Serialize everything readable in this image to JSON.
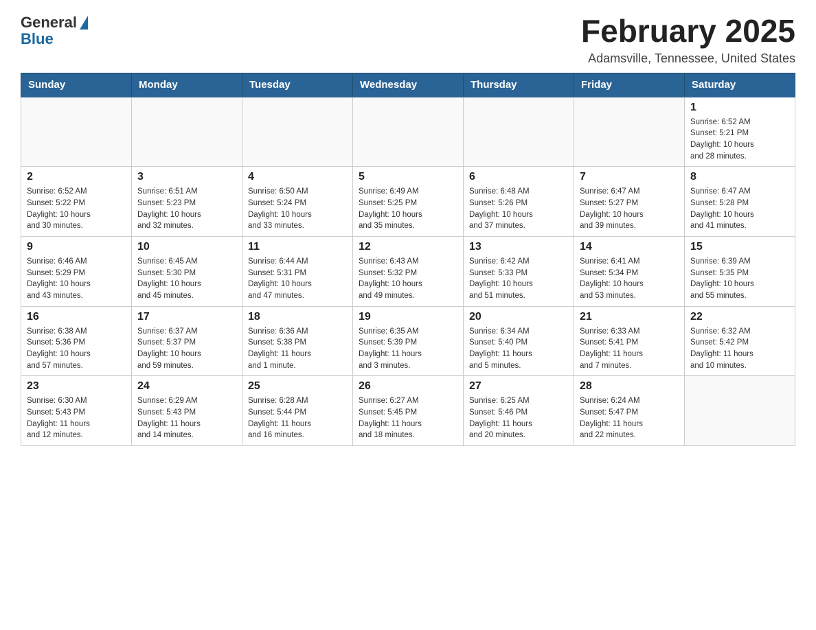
{
  "header": {
    "logo_general": "General",
    "logo_blue": "Blue",
    "month_year": "February 2025",
    "location": "Adamsville, Tennessee, United States"
  },
  "weekdays": [
    "Sunday",
    "Monday",
    "Tuesday",
    "Wednesday",
    "Thursday",
    "Friday",
    "Saturday"
  ],
  "weeks": [
    [
      {
        "day": "",
        "info": ""
      },
      {
        "day": "",
        "info": ""
      },
      {
        "day": "",
        "info": ""
      },
      {
        "day": "",
        "info": ""
      },
      {
        "day": "",
        "info": ""
      },
      {
        "day": "",
        "info": ""
      },
      {
        "day": "1",
        "info": "Sunrise: 6:52 AM\nSunset: 5:21 PM\nDaylight: 10 hours\nand 28 minutes."
      }
    ],
    [
      {
        "day": "2",
        "info": "Sunrise: 6:52 AM\nSunset: 5:22 PM\nDaylight: 10 hours\nand 30 minutes."
      },
      {
        "day": "3",
        "info": "Sunrise: 6:51 AM\nSunset: 5:23 PM\nDaylight: 10 hours\nand 32 minutes."
      },
      {
        "day": "4",
        "info": "Sunrise: 6:50 AM\nSunset: 5:24 PM\nDaylight: 10 hours\nand 33 minutes."
      },
      {
        "day": "5",
        "info": "Sunrise: 6:49 AM\nSunset: 5:25 PM\nDaylight: 10 hours\nand 35 minutes."
      },
      {
        "day": "6",
        "info": "Sunrise: 6:48 AM\nSunset: 5:26 PM\nDaylight: 10 hours\nand 37 minutes."
      },
      {
        "day": "7",
        "info": "Sunrise: 6:47 AM\nSunset: 5:27 PM\nDaylight: 10 hours\nand 39 minutes."
      },
      {
        "day": "8",
        "info": "Sunrise: 6:47 AM\nSunset: 5:28 PM\nDaylight: 10 hours\nand 41 minutes."
      }
    ],
    [
      {
        "day": "9",
        "info": "Sunrise: 6:46 AM\nSunset: 5:29 PM\nDaylight: 10 hours\nand 43 minutes."
      },
      {
        "day": "10",
        "info": "Sunrise: 6:45 AM\nSunset: 5:30 PM\nDaylight: 10 hours\nand 45 minutes."
      },
      {
        "day": "11",
        "info": "Sunrise: 6:44 AM\nSunset: 5:31 PM\nDaylight: 10 hours\nand 47 minutes."
      },
      {
        "day": "12",
        "info": "Sunrise: 6:43 AM\nSunset: 5:32 PM\nDaylight: 10 hours\nand 49 minutes."
      },
      {
        "day": "13",
        "info": "Sunrise: 6:42 AM\nSunset: 5:33 PM\nDaylight: 10 hours\nand 51 minutes."
      },
      {
        "day": "14",
        "info": "Sunrise: 6:41 AM\nSunset: 5:34 PM\nDaylight: 10 hours\nand 53 minutes."
      },
      {
        "day": "15",
        "info": "Sunrise: 6:39 AM\nSunset: 5:35 PM\nDaylight: 10 hours\nand 55 minutes."
      }
    ],
    [
      {
        "day": "16",
        "info": "Sunrise: 6:38 AM\nSunset: 5:36 PM\nDaylight: 10 hours\nand 57 minutes."
      },
      {
        "day": "17",
        "info": "Sunrise: 6:37 AM\nSunset: 5:37 PM\nDaylight: 10 hours\nand 59 minutes."
      },
      {
        "day": "18",
        "info": "Sunrise: 6:36 AM\nSunset: 5:38 PM\nDaylight: 11 hours\nand 1 minute."
      },
      {
        "day": "19",
        "info": "Sunrise: 6:35 AM\nSunset: 5:39 PM\nDaylight: 11 hours\nand 3 minutes."
      },
      {
        "day": "20",
        "info": "Sunrise: 6:34 AM\nSunset: 5:40 PM\nDaylight: 11 hours\nand 5 minutes."
      },
      {
        "day": "21",
        "info": "Sunrise: 6:33 AM\nSunset: 5:41 PM\nDaylight: 11 hours\nand 7 minutes."
      },
      {
        "day": "22",
        "info": "Sunrise: 6:32 AM\nSunset: 5:42 PM\nDaylight: 11 hours\nand 10 minutes."
      }
    ],
    [
      {
        "day": "23",
        "info": "Sunrise: 6:30 AM\nSunset: 5:43 PM\nDaylight: 11 hours\nand 12 minutes."
      },
      {
        "day": "24",
        "info": "Sunrise: 6:29 AM\nSunset: 5:43 PM\nDaylight: 11 hours\nand 14 minutes."
      },
      {
        "day": "25",
        "info": "Sunrise: 6:28 AM\nSunset: 5:44 PM\nDaylight: 11 hours\nand 16 minutes."
      },
      {
        "day": "26",
        "info": "Sunrise: 6:27 AM\nSunset: 5:45 PM\nDaylight: 11 hours\nand 18 minutes."
      },
      {
        "day": "27",
        "info": "Sunrise: 6:25 AM\nSunset: 5:46 PM\nDaylight: 11 hours\nand 20 minutes."
      },
      {
        "day": "28",
        "info": "Sunrise: 6:24 AM\nSunset: 5:47 PM\nDaylight: 11 hours\nand 22 minutes."
      },
      {
        "day": "",
        "info": ""
      }
    ]
  ]
}
